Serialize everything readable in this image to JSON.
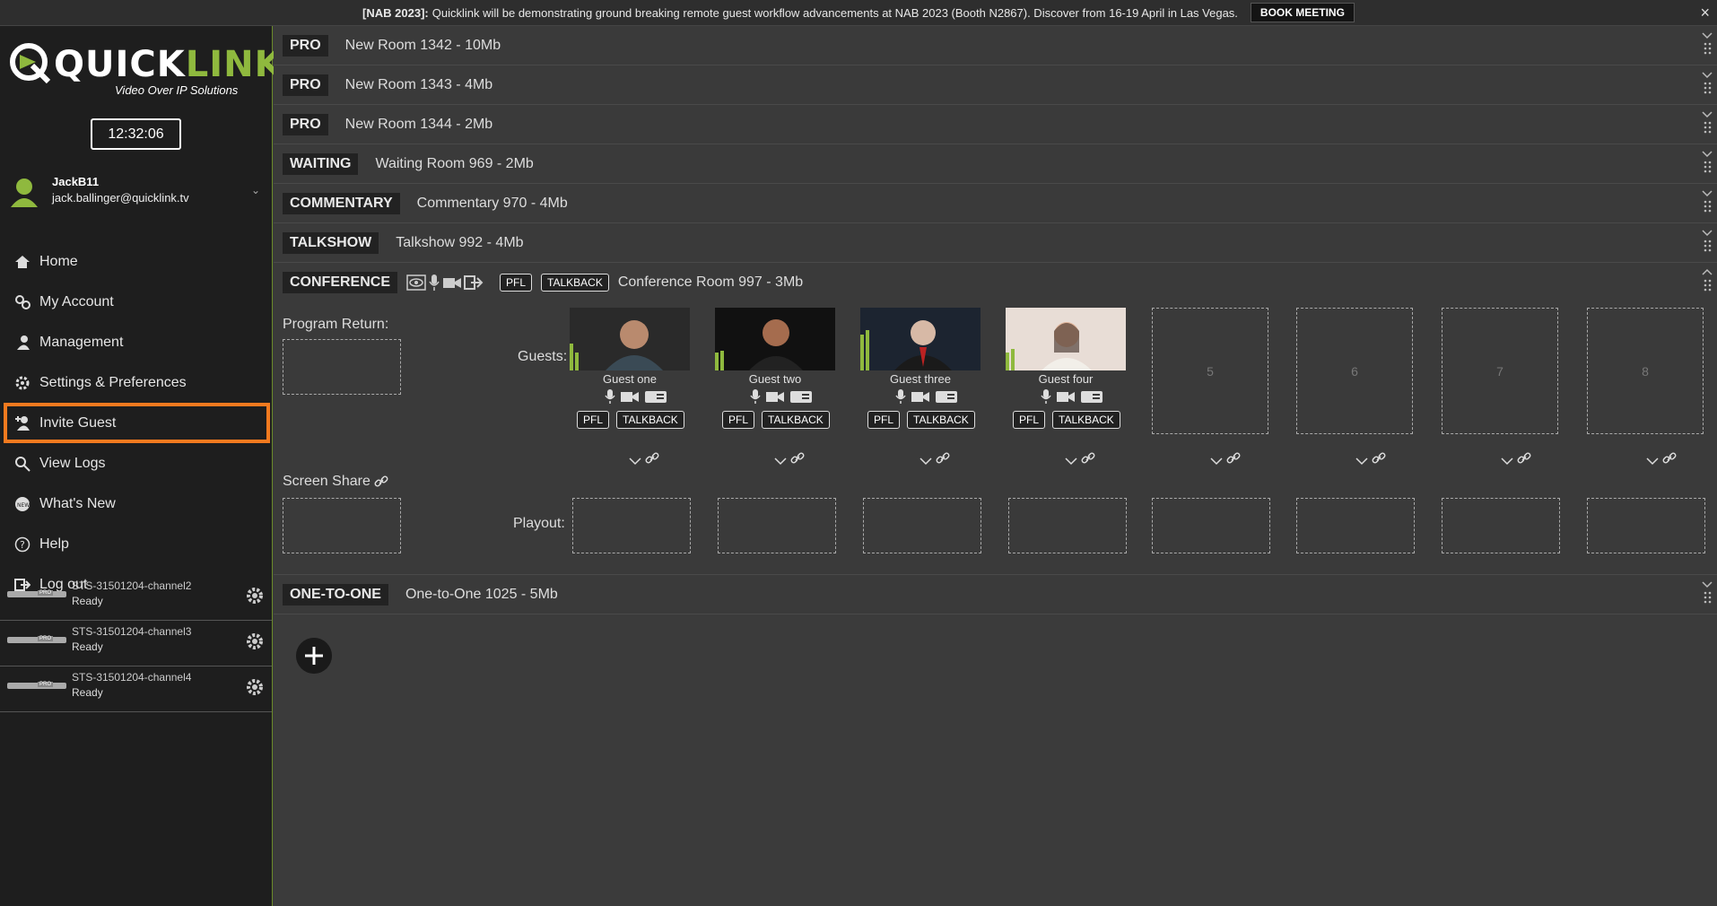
{
  "banner": {
    "tag": "[NAB 2023]:",
    "text": "Quicklink will be demonstrating ground breaking remote guest workflow advancements at NAB 2023 (Booth N2867). Discover from 16-19 April in Las Vegas.",
    "button": "BOOK MEETING",
    "close": "×"
  },
  "logo": {
    "word_main": "QUICK",
    "word_accent": "LINK",
    "subtitle": "Video Over IP Solutions"
  },
  "clock": "12:32:06",
  "user": {
    "name": "JackB11",
    "email": "jack.ballinger@quicklink.tv"
  },
  "menu": [
    {
      "label": "Home",
      "icon": "home-icon"
    },
    {
      "label": "My Account",
      "icon": "account-icon"
    },
    {
      "label": "Management",
      "icon": "management-icon"
    },
    {
      "label": "Settings & Preferences",
      "icon": "settings-icon"
    },
    {
      "label": "Invite Guest",
      "icon": "invite-icon",
      "active": true
    },
    {
      "label": "View Logs",
      "icon": "search-icon"
    },
    {
      "label": "What's New",
      "icon": "new-icon"
    },
    {
      "label": "Help",
      "icon": "help-icon"
    },
    {
      "label": "Log out",
      "icon": "logout-icon"
    }
  ],
  "channels": [
    {
      "name": "STS-31501204-channel2",
      "status": "Ready",
      "badge": "PRO"
    },
    {
      "name": "STS-31501204-channel3",
      "status": "Ready",
      "badge": "PRO"
    },
    {
      "name": "STS-31501204-channel4",
      "status": "Ready",
      "badge": "PRO"
    }
  ],
  "rooms": [
    {
      "type": "PRO",
      "name": "New Room 1342 - 10Mb"
    },
    {
      "type": "PRO",
      "name": "New Room 1343 - 4Mb"
    },
    {
      "type": "PRO",
      "name": "New Room 1344 - 2Mb"
    },
    {
      "type": "WAITING",
      "name": "Waiting Room 969 - 2Mb"
    },
    {
      "type": "COMMENTARY",
      "name": "Commentary 970 - 4Mb"
    },
    {
      "type": "TALKSHOW",
      "name": "Talkshow 992 - 4Mb"
    }
  ],
  "conference": {
    "type": "CONFERENCE",
    "name": "Conference Room 997 - 3Mb",
    "pfl": "PFL",
    "talkback": "TALKBACK",
    "program_return": "Program Return:",
    "guests_label": "Guests:",
    "screen_share": "Screen Share",
    "playout": "Playout:",
    "guests": [
      {
        "name": "Guest one",
        "pfl": "PFL",
        "talkback": "TALKBACK"
      },
      {
        "name": "Guest two",
        "pfl": "PFL",
        "talkback": "TALKBACK"
      },
      {
        "name": "Guest three",
        "pfl": "PFL",
        "talkback": "TALKBACK"
      },
      {
        "name": "Guest four",
        "pfl": "PFL",
        "talkback": "TALKBACK"
      }
    ],
    "empty_slots": [
      "5",
      "6",
      "7",
      "8"
    ]
  },
  "one_to_one": {
    "type": "ONE-TO-ONE",
    "name": "One-to-One 1025 - 5Mb"
  },
  "colors": {
    "accent_orange": "#f37a1f",
    "brand_green": "#8fb93e",
    "audio_meter": "#8fb93e"
  }
}
